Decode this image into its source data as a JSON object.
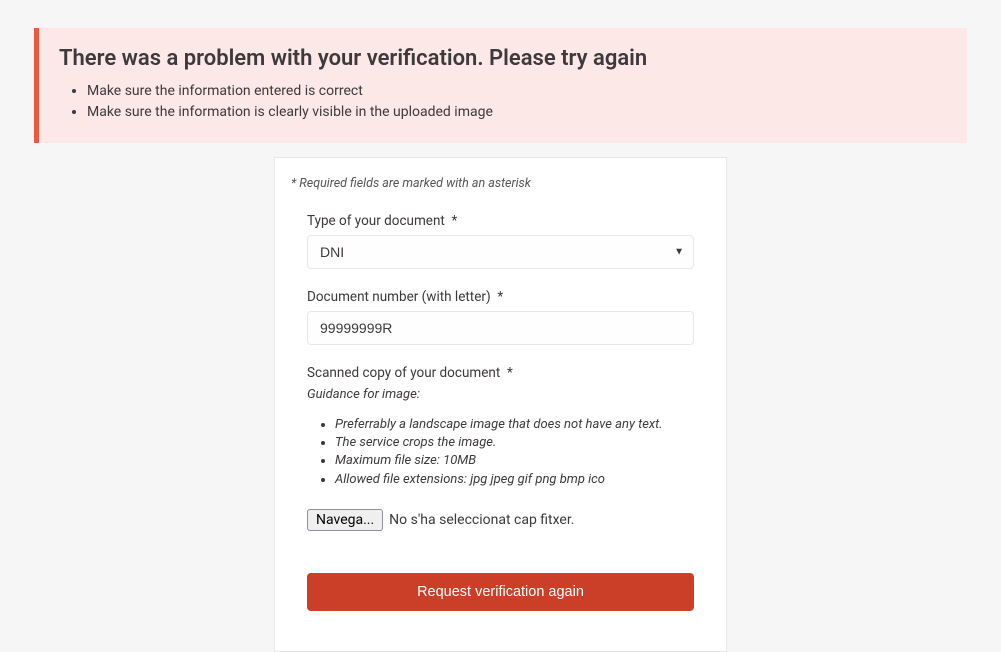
{
  "alert": {
    "title": "There was a problem with your verification. Please try again",
    "items": [
      "Make sure the information entered is correct",
      "Make sure the information is clearly visible in the uploaded image"
    ]
  },
  "form": {
    "required_note": "* Required fields are marked with an asterisk",
    "document_type": {
      "label": "Type of your document",
      "required_mark": "*",
      "selected": "DNI"
    },
    "document_number": {
      "label": "Document number (with letter)",
      "required_mark": "*",
      "value": "99999999R"
    },
    "scanned_copy": {
      "label": "Scanned copy of your document",
      "required_mark": "*",
      "guidance_title": "Guidance for image:",
      "guidance": [
        "Preferrably a landscape image that does not have any text.",
        "The service crops the image.",
        "Maximum file size: 10MB",
        "Allowed file extensions: jpg jpeg gif png bmp ico"
      ],
      "browse_label": "Navega...",
      "file_status": "No s'ha seleccionat cap fitxer."
    },
    "submit_label": "Request verification again"
  }
}
